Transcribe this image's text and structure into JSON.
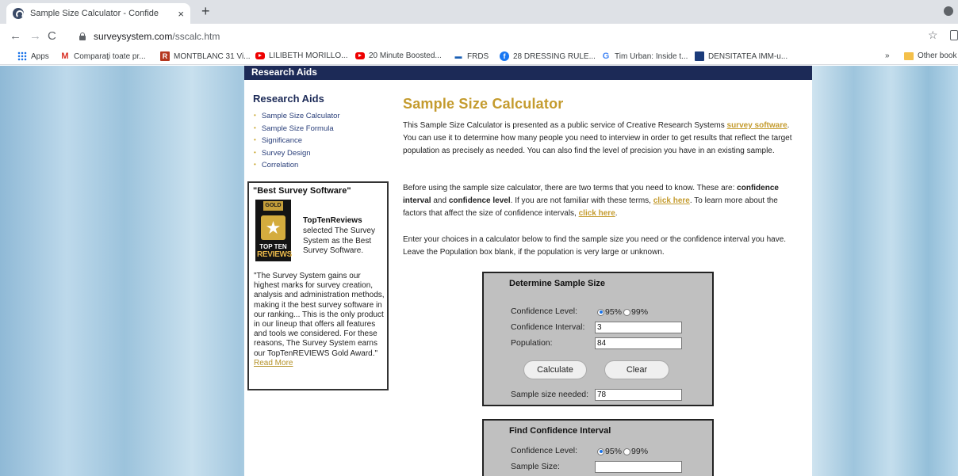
{
  "browser": {
    "tab_title": "Sample Size Calculator - Confide",
    "tab_close": "×",
    "new_tab": "+",
    "url_domain": "surveysystem.com",
    "url_path": "/sscalc.htm",
    "nav": {
      "back": "←",
      "forward": "→",
      "reload": "C"
    },
    "star": "☆",
    "bookmarks": [
      {
        "label": "Apps",
        "icon": "apps-icon"
      },
      {
        "label": "Comparaţi toate pr...",
        "icon": "gmail-icon"
      },
      {
        "label": "MONTBLANC 31 Vi...",
        "icon": "r-logo-icon"
      },
      {
        "label": "LILIBETH MORILLO...",
        "icon": "youtube-icon"
      },
      {
        "label": "20 Minute Boosted...",
        "icon": "youtube-icon"
      },
      {
        "label": "FRDS",
        "icon": "frds-icon"
      },
      {
        "label": "28 DRESSING RULE...",
        "icon": "facebook-icon"
      },
      {
        "label": "Tim Urban: Inside t...",
        "icon": "google-icon"
      },
      {
        "label": "DENSITATEA IMM-u...",
        "icon": "site-icon"
      }
    ],
    "bookmarks_more": "»",
    "other_bookmarks": "Other book"
  },
  "page": {
    "topbar_title": "Research Aids",
    "sidebar": {
      "heading": "Research Aids",
      "items": [
        "Sample Size Calculator",
        "Sample Size Formula",
        "Significance",
        "Survey Design",
        "Correlation"
      ]
    },
    "award": {
      "title": "\"Best Survey Software\"",
      "logo_gold": "GOLD",
      "logo_top": "TOP TEN",
      "logo_reviews": "REVIEWS",
      "brand": "TopTenReviews",
      "selected_text": "selected The Survey System as the Best Survey Software.",
      "quote": "\"The Survey System gains our highest marks for survey creation, analysis and administration methods, making it the best survey software in our ranking... This is the only product in our lineup that offers all features and tools we considered. For these reasons, The Survey System earns our TopTenREVIEWS Gold Award.\"",
      "read_more": "Read More"
    },
    "main_title": "Sample Size Calculator",
    "p1": {
      "a": "This Sample Size Calculator is presented as a public service of Creative Research Systems ",
      "link": "survey software",
      "b": ". You can use it to determine how many people you need to interview in order to get results that reflect the target population as precisely as needed. You can also find the level of precision you have in an existing sample."
    },
    "p2": {
      "a": "Before using the sample size calculator, there are two terms that you need to know. These are: ",
      "bold1": "confidence interval",
      "and": " and ",
      "bold2": "confidence level",
      "b": ". If you are not familiar with these terms, ",
      "link1": "click here",
      "c": ". To learn more about the factors that affect the size of confidence intervals, ",
      "link2": "click here",
      "d": "."
    },
    "p3": "Enter your choices in a calculator below to find the sample size you need or the confidence interval you have. Leave the Population box blank, if the population is very large or unknown.",
    "determine": {
      "title": "Determine Sample Size",
      "confidence_level_label": "Confidence Level:",
      "opt_95": "95%",
      "opt_99": "99%",
      "interval_label": "Confidence Interval:",
      "interval_value": "3",
      "population_label": "Population:",
      "population_value": "84",
      "calculate": "Calculate",
      "clear": "Clear",
      "result_label": "Sample size needed:",
      "result_value": "78"
    },
    "find": {
      "title": "Find Confidence Interval",
      "confidence_level_label": "Confidence Level:",
      "opt_95": "95%",
      "opt_99": "99%",
      "sample_label": "Sample Size:",
      "sample_value": ""
    }
  }
}
